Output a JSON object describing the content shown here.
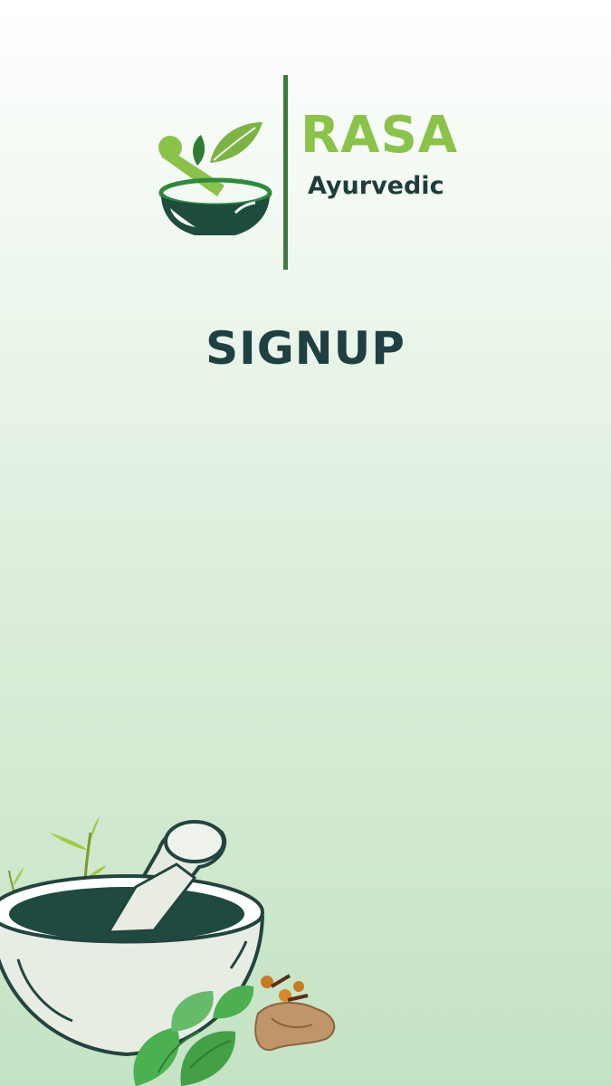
{
  "brand": {
    "name": "RASA",
    "subtitle": "Ayurvedic",
    "accent_color": "#8bc34a",
    "dark_color": "#1e3d3a"
  },
  "page": {
    "title": "SIGNUP",
    "title_color": "#1e4040"
  },
  "illustration": {
    "icon": "mortar-and-pestle-herbs-illustration"
  }
}
